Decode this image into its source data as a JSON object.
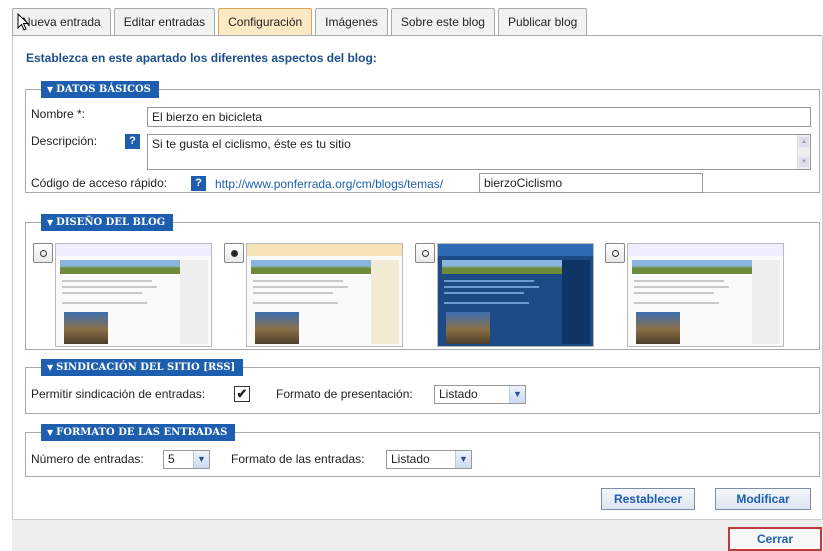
{
  "tabs": [
    {
      "label": "Nueva entrada"
    },
    {
      "label": "Editar entradas"
    },
    {
      "label": "Configuración",
      "active": true
    },
    {
      "label": "Imágenes"
    },
    {
      "label": "Sobre este blog"
    },
    {
      "label": "Publicar blog"
    }
  ],
  "intro": "Establezca en este apartado los diferentes aspectos del blog:",
  "basic": {
    "legend": "DATOS BÁSICOS",
    "name_label": "Nombre *:",
    "name_value": "El bierzo en bicicleta",
    "desc_label": "Descripción:",
    "desc_value": "Si te gusta el ciclismo, éste es tu sitio",
    "help_glyph": "?",
    "shortcut_label": "Código de acceso rápido:",
    "shortcut_url": "http://www.ponferrada.org/cm/blogs/temas/",
    "shortcut_value": "bierzoCiclismo"
  },
  "design": {
    "legend": "DISEÑO DEL BLOG",
    "options": [
      {
        "selected": false,
        "theme": "light"
      },
      {
        "selected": true,
        "theme": "light"
      },
      {
        "selected": false,
        "theme": "blue"
      },
      {
        "selected": false,
        "theme": "light"
      }
    ]
  },
  "rss": {
    "legend": "SINDICACIÓN DEL SITIO [RSS]",
    "allow_label": "Permitir sindicación de entradas:",
    "allow_checked": true,
    "check_glyph": "✔",
    "format_label": "Formato de presentación:",
    "format_value": "Listado"
  },
  "entries": {
    "legend": "FORMATO DE LAS ENTRADAS",
    "count_label": "Número de entradas:",
    "count_value": "5",
    "format_label": "Formato de las entradas:",
    "format_value": "Listado"
  },
  "buttons": {
    "reset": "Restablecer",
    "modify": "Modificar",
    "close": "Cerrar"
  },
  "colors": {
    "accent": "#1d5fae",
    "active_tab": "#fde9c4",
    "close_border": "#c2393a"
  }
}
